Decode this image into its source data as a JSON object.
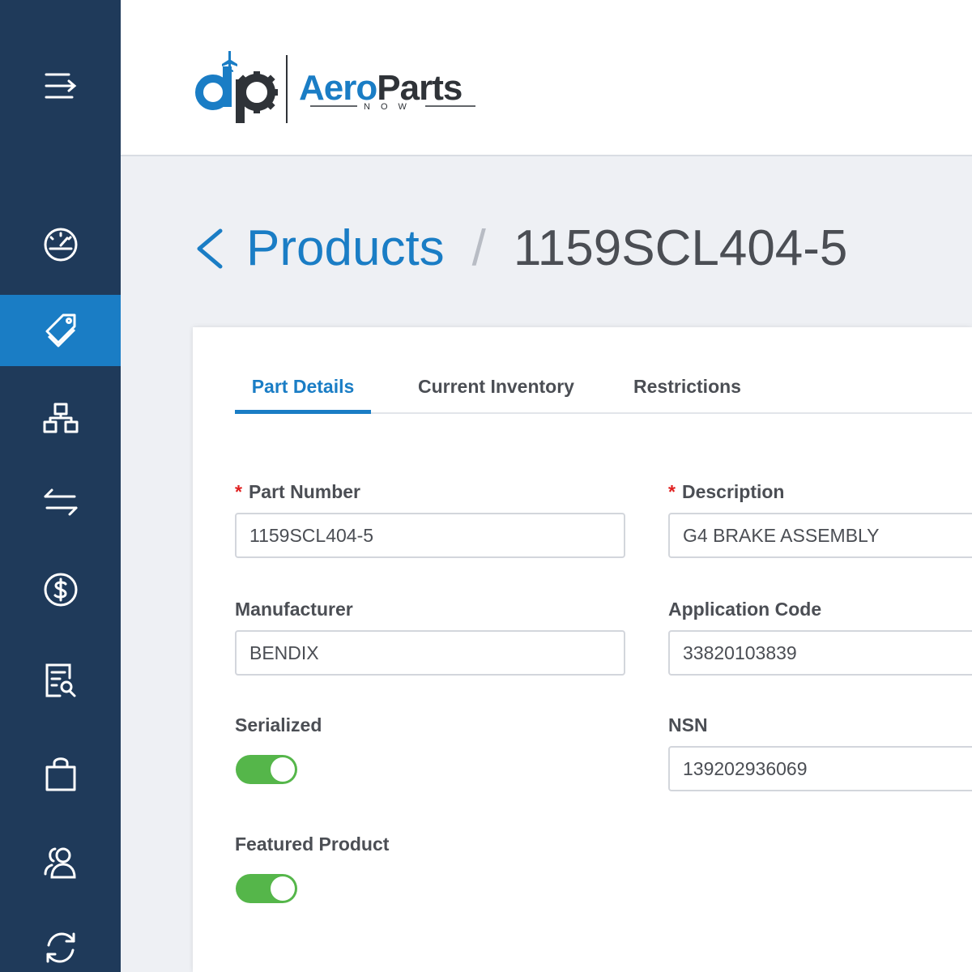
{
  "app": {
    "brand": "AeroParts",
    "brand_sub": "NOW",
    "colors": {
      "sidebar": "#1f3a5a",
      "accent": "#1a7dc5",
      "toggle_on": "#55b64a",
      "required": "#e02020"
    }
  },
  "sidebar": {
    "items": [
      {
        "icon": "menu-icon"
      },
      {
        "icon": "dashboard-gauge-icon"
      },
      {
        "icon": "tags-icon",
        "active": true
      },
      {
        "icon": "hierarchy-icon"
      },
      {
        "icon": "transfer-arrows-icon"
      },
      {
        "icon": "dollar-circle-icon"
      },
      {
        "icon": "document-search-icon"
      },
      {
        "icon": "shopping-bag-icon"
      },
      {
        "icon": "users-icon"
      },
      {
        "icon": "sync-icon"
      }
    ]
  },
  "breadcrumb": {
    "parent": "Products",
    "separator": "/",
    "current": "1159SCL404-5"
  },
  "tabs": [
    {
      "label": "Part Details",
      "active": true
    },
    {
      "label": "Current Inventory"
    },
    {
      "label": "Restrictions"
    }
  ],
  "form": {
    "part_number": {
      "label": "Part Number",
      "required": "*",
      "value": "1159SCL404-5"
    },
    "description": {
      "label": "Description",
      "required": "*",
      "value": "G4 BRAKE ASSEMBLY"
    },
    "manufacturer": {
      "label": "Manufacturer",
      "value": "BENDIX"
    },
    "application_code": {
      "label": "Application Code",
      "value": "33820103839"
    },
    "serialized": {
      "label": "Serialized",
      "on": true
    },
    "nsn": {
      "label": "NSN",
      "value": "139202936069"
    },
    "featured": {
      "label": "Featured Product",
      "on": true
    }
  }
}
